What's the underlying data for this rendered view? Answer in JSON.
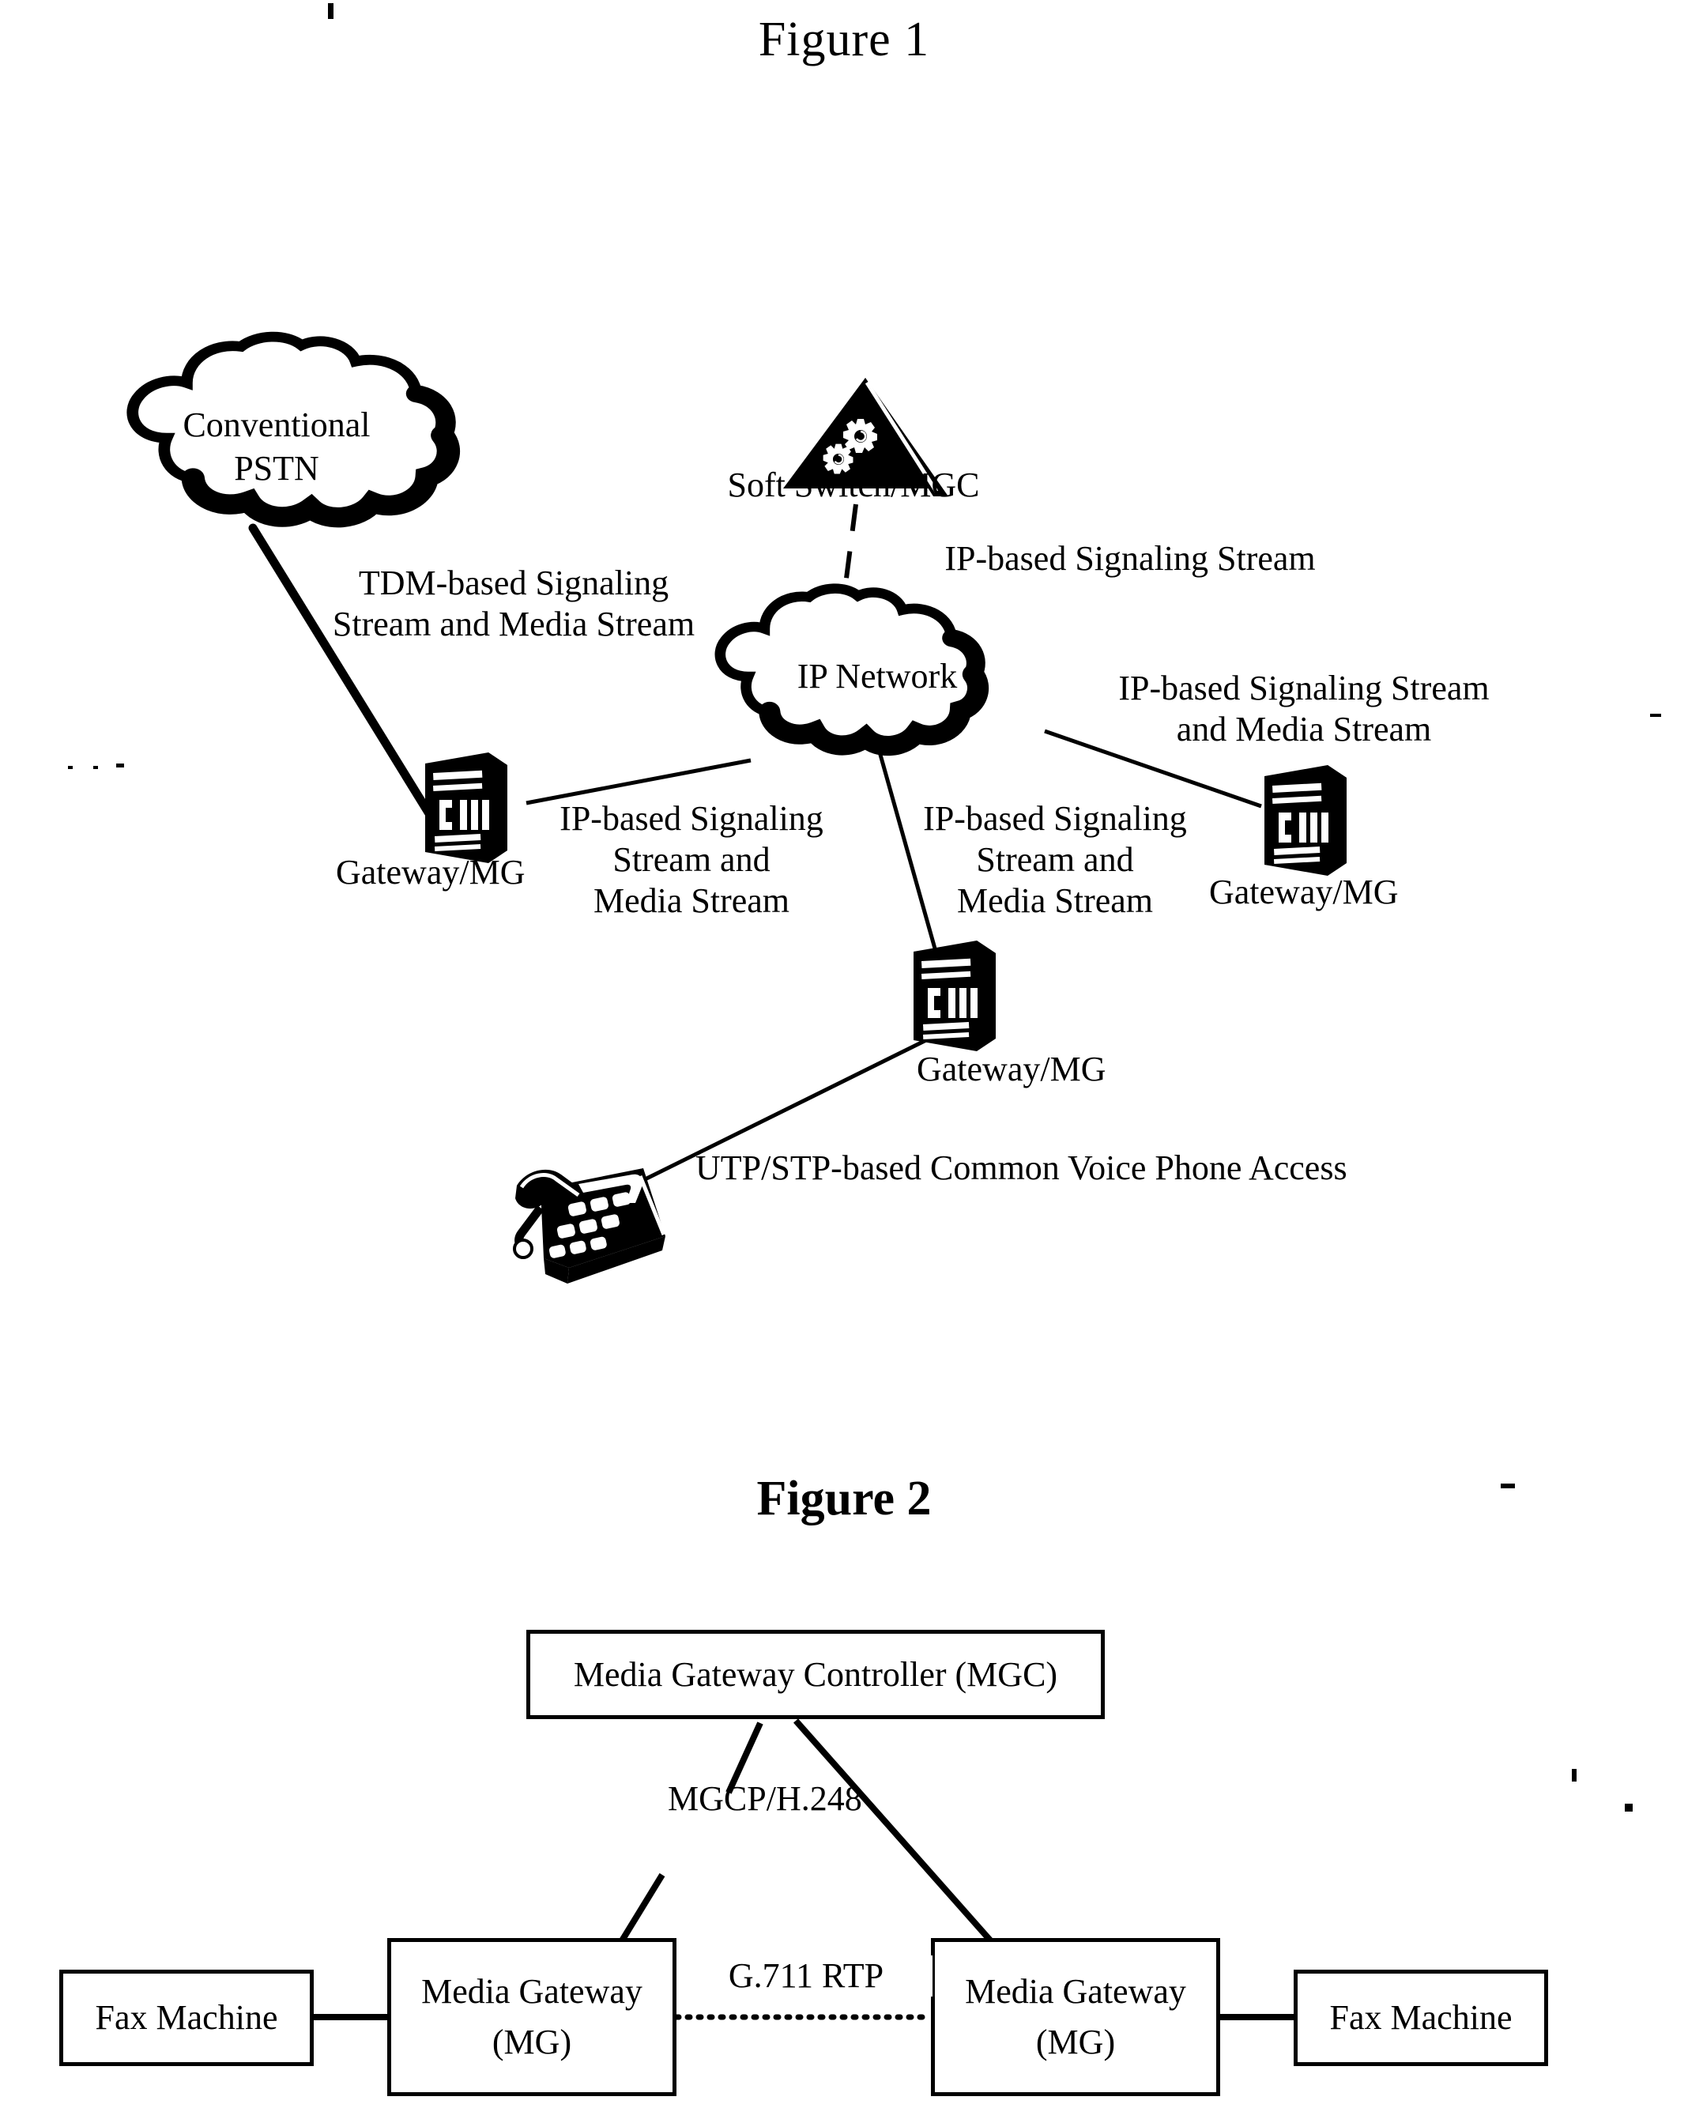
{
  "figure1": {
    "title": "Figure 1",
    "nodes": {
      "pstn": {
        "label_line1": "Conventional",
        "label_line2": "PSTN",
        "icon": "cloud-icon"
      },
      "softswitch": {
        "label": "Soft Switch/MGC",
        "icon": "pyramid-gears-icon"
      },
      "ipnetwork": {
        "label": "IP Network",
        "icon": "cloud-icon"
      },
      "gateway_left": {
        "label": "Gateway/MG",
        "icon": "gateway-device-icon"
      },
      "gateway_right": {
        "label": "Gateway/MG",
        "icon": "gateway-device-icon"
      },
      "gateway_bottom": {
        "label": "Gateway/MG",
        "icon": "gateway-device-icon"
      },
      "phone": {
        "icon": "desk-phone-icon"
      }
    },
    "link_labels": {
      "tdm": "TDM-based Signaling\nStream and Media Stream",
      "mgc_signaling": "IP-based Signaling Stream",
      "right_stream": "IP-based Signaling Stream\nand Media Stream",
      "left_gateway_stream": "IP-based Signaling\nStream and\nMedia Stream",
      "bottom_gateway_stream": "IP-based Signaling\nStream and\nMedia Stream",
      "phone_access": "UTP/STP-based Common Voice Phone Access"
    }
  },
  "figure2": {
    "title": "Figure 2",
    "boxes": {
      "mgc": "Media Gateway Controller (MGC)",
      "mg_left": "Media Gateway\n(MG)",
      "mg_right": "Media Gateway\n(MG)",
      "fax_left": "Fax Machine",
      "fax_right": "Fax Machine"
    },
    "link_labels": {
      "mgcp": "MGCP/H.248",
      "rtp": "G.711 RTP"
    }
  },
  "colors": {
    "ink": "#000000",
    "paper": "#ffffff"
  }
}
